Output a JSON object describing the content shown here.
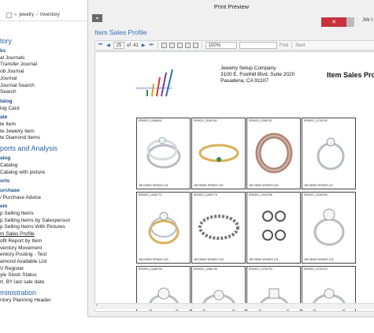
{
  "background_app": {
    "breadcrumb": [
      "jewelry",
      "Inventory"
    ],
    "nav": {
      "group_title": "tory",
      "sections": [
        {
          "title": "ks",
          "items": [
            "al Journals",
            "Transfer Journal",
            "ob Journal",
            "Journal",
            "Journal Search",
            "Search"
          ]
        },
        {
          "title": "talog",
          "items": [
            "log Card"
          ]
        },
        {
          "title": "ate",
          "items": [
            "te Item",
            "te Jewelry Item",
            "te Diamond Items"
          ]
        }
      ],
      "group_title_2": "ports and Analysis",
      "sections_2": [
        {
          "title": "alog",
          "items": [
            "Catalog",
            "Catalog with picture"
          ]
        },
        {
          "title": "orts",
          "items": []
        },
        {
          "title": "urchase",
          "items": [
            "/ Purchase Advice"
          ]
        },
        {
          "title": "em",
          "items": [
            "p Selling Items",
            "p Selling Items by Salesperson",
            "p Selling Items With Pictures",
            "m Sales Profile",
            "ofit Report by Item",
            "ventory Movement",
            "entory Posting - Test",
            "amond Available List",
            "V Register",
            "yle Stock Status",
            "rt. BY last sale date"
          ]
        }
      ],
      "group_title_3": "ministration",
      "items_3": [
        "ntory Planning Header"
      ]
    }
  },
  "preview": {
    "window_title": "Print Preview",
    "menu_btn": "▾",
    "title": "Item Sales Profile",
    "close_label": "✕",
    "user": "JW I",
    "toolbar": {
      "first": "⏮",
      "prev": "◀",
      "page": "25",
      "of_label": "of",
      "total": "41",
      "next": "▶",
      "last": "⏭",
      "zoom": "100%",
      "find_label": "Find",
      "next_label": "Next"
    },
    "report": {
      "logo_text": "BUSINESS COMPUTING",
      "company_name": "Jewelry Setup Company",
      "address1": "3100 E. Foothill Blvd. Suite 2020",
      "address2": "Pasadena, CA  91107",
      "heading": "Item Sales Pro",
      "cells": [
        {
          "sku": "ERNGS_1148/691",
          "desc": "JW DEMO ERNGS 114"
        },
        {
          "sku": "ERNGS_1155/740",
          "desc": "JW DEMO ERNGS 115"
        },
        {
          "sku": "ERNGS_1159/742",
          "desc": "JW DEMO ERNGS 116"
        },
        {
          "sku": "ERNGS_1175/745",
          "desc": "JW DEMO ERNGS 117"
        },
        {
          "sku": "ERNGS_1156/770",
          "desc": "JW DEMO ERNGS 119"
        },
        {
          "sku": "ERNGS_1265/775",
          "desc": "JW DEMO ERNGS 120"
        },
        {
          "sku": "ERNGS_1216/755",
          "desc": "JW DEMO ERNGS 121"
        },
        {
          "sku": "ERNGS_1228/750",
          "desc": "JW DEMO ERNGS 122"
        },
        {
          "sku": "ERNGS_1248/759",
          "desc": ""
        },
        {
          "sku": "ERNGS_1256/746",
          "desc": ""
        },
        {
          "sku": "ERNGS_1276/730",
          "desc": ""
        },
        {
          "sku": "ERNGS_1276/723",
          "desc": ""
        }
      ]
    }
  },
  "colors": {
    "accent": "#2f6fb7",
    "close": "#c7323d",
    "gold": "#d8b15a",
    "silver": "#b9bcc2",
    "rose": "#b9826a"
  }
}
